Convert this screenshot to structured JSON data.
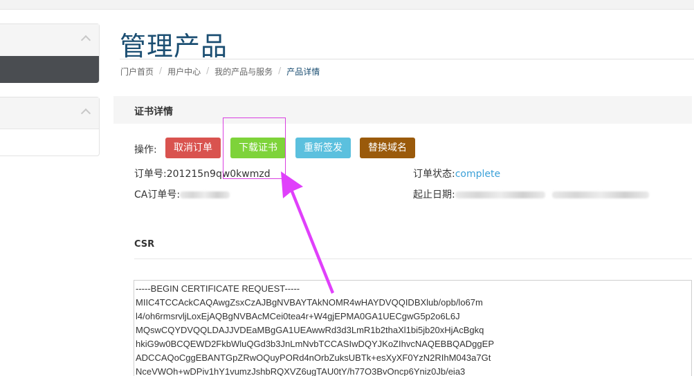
{
  "page": {
    "title": "管理产品"
  },
  "breadcrumb": {
    "items": [
      "门户首页",
      "用户中心",
      "我的产品与服务"
    ],
    "active": "产品详情",
    "separator": "/"
  },
  "card": {
    "title": "证书详情"
  },
  "operations": {
    "label": "操作:",
    "buttons": {
      "cancel": "取消订单",
      "download": "下载证书",
      "reissue": "重新签发",
      "replace": "替换域名"
    }
  },
  "order": {
    "order_no_label": "订单号:",
    "order_no_value": "201215n9qw0kwmzd",
    "ca_no_label": "CA订单号:",
    "status_label": "订单状态:",
    "status_value": "complete",
    "period_label": "起止日期:"
  },
  "csr": {
    "title": "CSR",
    "lines": [
      "-----BEGIN CERTIFICATE REQUEST-----",
      "MIIC4TCCAckCAQAwgZsxCzAJBgNVBAYTAkNOMR4wHAYDVQQIDBXlub/opb/lo67m",
      "l4/oh6rmsrvljLoxEjAQBgNVBAcMCei0tea4r+W4gjEPMA0GA1UECgwG5p2o6L6J",
      "MQswCQYDVQQLDAJJVDEaMBgGA1UEAwwRd3d3LmR1b2thaXl1bi5jb20xHjAcBgkq",
      "hkiG9w0BCQEWD2FkbWluQGd3b3JnLmNvbTCCASIwDQYJKoZIhvcNAQEBBQADggEP",
      "ADCCAQoCggEBANTGpZRwOQuyPORd4nOrbZuksUBTk+esXyXF0YzN2RIhM043a7Gt",
      "NceVWOh+wDPiv1hY1vumzJshbRQXVZ6ugTAU0tY/h77O3BvOncp6Yniz0Jb/eia3"
    ]
  },
  "colors": {
    "title": "#1b4e72",
    "cancel": "#d9534f",
    "download": "#7ed33a",
    "reissue": "#5bc0de",
    "replace": "#9a5a0b",
    "annotation": "#e040fb",
    "status_link": "#3aa0d8"
  }
}
